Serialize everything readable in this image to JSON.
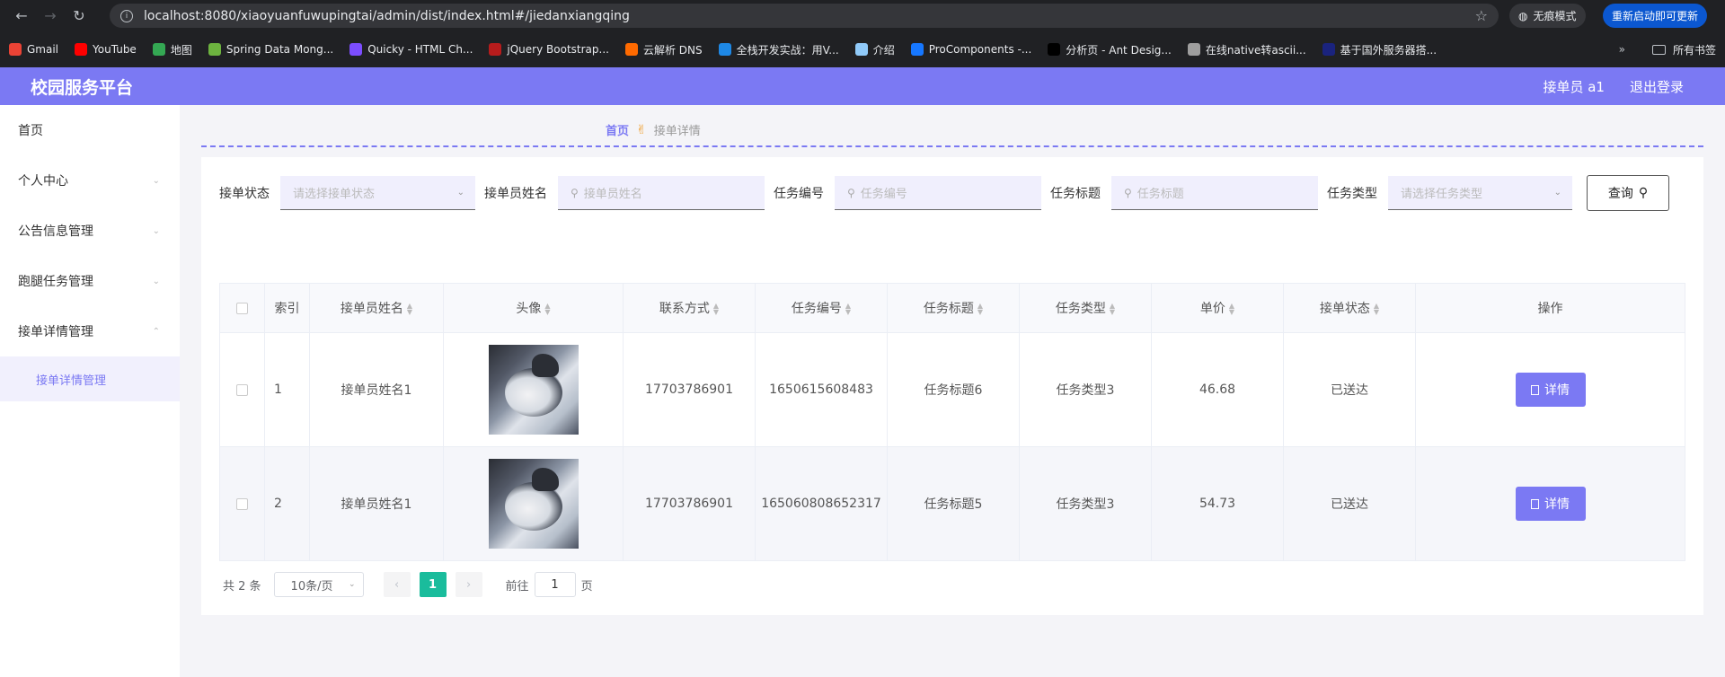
{
  "browser": {
    "url": "localhost:8080/xiaoyuanfuwupingtai/admin/dist/index.html#/jiedanxiangqing",
    "incognito_label": "无痕模式",
    "update_label": "重新启动即可更新",
    "bookmarks": [
      {
        "label": "Gmail",
        "color": "#ea4335"
      },
      {
        "label": "YouTube",
        "color": "#ff0000"
      },
      {
        "label": "地图",
        "color": "#34a853"
      },
      {
        "label": "Spring Data Mong...",
        "color": "#6db33f"
      },
      {
        "label": "Quicky - HTML Ch...",
        "color": "#7c4dff"
      },
      {
        "label": "jQuery Bootstrap...",
        "color": "#b71c1c"
      },
      {
        "label": "云解析 DNS",
        "color": "#ff6a00"
      },
      {
        "label": "全栈开发实战：用V...",
        "color": "#1e88e5"
      },
      {
        "label": "介绍",
        "color": "#90caf9"
      },
      {
        "label": "ProComponents -...",
        "color": "#1677ff"
      },
      {
        "label": "分析页 - Ant Desig...",
        "color": "#000000"
      },
      {
        "label": "在线native转ascii...",
        "color": "#9e9e9e"
      },
      {
        "label": "基于国外服务器搭...",
        "color": "#1a237e"
      }
    ],
    "all_bookmarks_label": "所有书签"
  },
  "header": {
    "title": "校园服务平台",
    "user": "接单员 a1",
    "logout": "退出登录"
  },
  "sidebar": {
    "items": [
      {
        "label": "首页",
        "has_arrow": false
      },
      {
        "label": "个人中心",
        "has_arrow": true
      },
      {
        "label": "公告信息管理",
        "has_arrow": true
      },
      {
        "label": "跑腿任务管理",
        "has_arrow": true
      },
      {
        "label": "接单详情管理",
        "has_arrow": true,
        "expanded": true
      }
    ],
    "subitem": "接单详情管理"
  },
  "breadcrumb": {
    "home": "首页",
    "current": "接单详情"
  },
  "filters": {
    "status_label": "接单状态",
    "status_placeholder": "请选择接单状态",
    "name_label": "接单员姓名",
    "name_placeholder": "接单员姓名",
    "task_no_label": "任务编号",
    "task_no_placeholder": "任务编号",
    "task_title_label": "任务标题",
    "task_title_placeholder": "任务标题",
    "task_type_label": "任务类型",
    "task_type_placeholder": "请选择任务类型",
    "query_button": "查询"
  },
  "table": {
    "headers": {
      "index": "索引",
      "name": "接单员姓名",
      "avatar": "头像",
      "contact": "联系方式",
      "task_no": "任务编号",
      "task_title": "任务标题",
      "task_type": "任务类型",
      "price": "单价",
      "status": "接单状态",
      "actions": "操作"
    },
    "rows": [
      {
        "index": "1",
        "name": "接单员姓名1",
        "contact": "17703786901",
        "task_no": "1650615608483",
        "task_title": "任务标题6",
        "task_type": "任务类型3",
        "price": "46.68",
        "status": "已送达",
        "action": "详情"
      },
      {
        "index": "2",
        "name": "接单员姓名1",
        "contact": "17703786901",
        "task_no": "165060808652317",
        "task_title": "任务标题5",
        "task_type": "任务类型3",
        "price": "54.73",
        "status": "已送达",
        "action": "详情"
      }
    ]
  },
  "pagination": {
    "total": "共 2 条",
    "page_size": "10条/页",
    "current_page": "1",
    "goto_label": "前往",
    "goto_value": "1",
    "goto_suffix": "页"
  },
  "colors": {
    "accent": "#7b79f3",
    "pager_active": "#1abc9c"
  }
}
